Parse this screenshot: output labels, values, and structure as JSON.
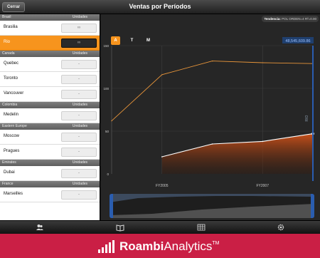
{
  "header": {
    "close_label": "Cerrar",
    "title": "Ventas por Períodos"
  },
  "sidebar": {
    "groups": [
      {
        "name": "Brasil",
        "units_label": "Unidades",
        "rows": [
          {
            "name": "Brasilia",
            "value": "∞",
            "selected": false
          },
          {
            "name": "Rio",
            "value": "∞",
            "selected": true
          }
        ]
      },
      {
        "name": "Canada",
        "units_label": "Unidades",
        "rows": [
          {
            "name": "Quebec",
            "value": "-"
          },
          {
            "name": "Toronto",
            "value": "-"
          },
          {
            "name": "Vancouver",
            "value": "-"
          }
        ]
      },
      {
        "name": "Colombia",
        "units_label": "Unidades",
        "rows": [
          {
            "name": "Medelin",
            "value": "-"
          }
        ]
      },
      {
        "name": "Eastern Europe",
        "units_label": "Unidades",
        "rows": [
          {
            "name": "Moscow",
            "value": "-"
          },
          {
            "name": "Pragues",
            "value": "-"
          }
        ]
      },
      {
        "name": "Emirates",
        "units_label": "Unidades",
        "rows": [
          {
            "name": "Dubai",
            "value": "-"
          }
        ]
      },
      {
        "name": "France",
        "units_label": "Unidades",
        "rows": [
          {
            "name": "Marseilles",
            "value": "-"
          }
        ]
      }
    ]
  },
  "chart_panel": {
    "trend_label": "Tendencia:",
    "trend_value": "POL ORDEN=4 R²=0.00",
    "period_buttons": [
      {
        "label": "A",
        "active": true
      },
      {
        "label": "T",
        "active": false
      },
      {
        "label": "M",
        "active": false
      }
    ],
    "value_badge": "48,545,609.86",
    "vertical_label": "RIO",
    "colors": {
      "accent": "#f7941d",
      "line_orange": "#e8953a",
      "line_white": "#ffffff",
      "cursor": "#2a5db0"
    }
  },
  "chart_data": {
    "type": "line",
    "title": "",
    "xlabel": "",
    "ylabel": "",
    "x_tick_labels": [
      "FY2005",
      "FY2007"
    ],
    "y_ticks": [
      0,
      50,
      100,
      150
    ],
    "ylim": [
      0,
      150
    ],
    "series": [
      {
        "points": [
          [
            0,
            62
          ],
          [
            0.25,
            116
          ],
          [
            0.5,
            132
          ],
          [
            0.75,
            130
          ],
          [
            1.0,
            129
          ]
        ]
      },
      {
        "points": [
          [
            0.25,
            20
          ],
          [
            0.5,
            35
          ],
          [
            0.75,
            38
          ],
          [
            1.0,
            47
          ]
        ],
        "filled": true
      }
    ]
  },
  "toolbar": {
    "icons": [
      "users-icon",
      "book-icon",
      "grid-icon",
      "gear-icon"
    ]
  },
  "brand": {
    "name_bold": "Roambi",
    "name_light": "Analytics",
    "trademark": "TM"
  }
}
